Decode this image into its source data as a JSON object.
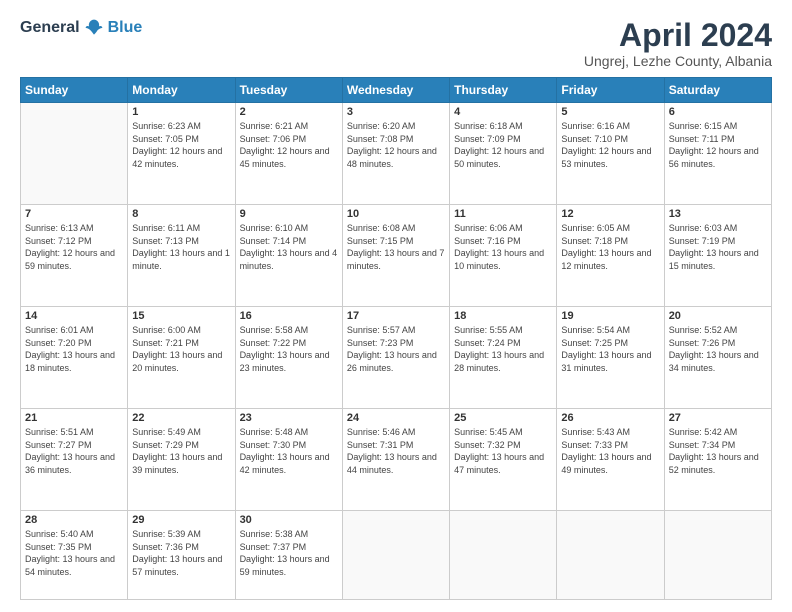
{
  "header": {
    "logo_general": "General",
    "logo_blue": "Blue",
    "month": "April 2024",
    "location": "Ungrej, Lezhe County, Albania"
  },
  "days_of_week": [
    "Sunday",
    "Monday",
    "Tuesday",
    "Wednesday",
    "Thursday",
    "Friday",
    "Saturday"
  ],
  "weeks": [
    [
      {
        "day": "",
        "sunrise": "",
        "sunset": "",
        "daylight": ""
      },
      {
        "day": "1",
        "sunrise": "Sunrise: 6:23 AM",
        "sunset": "Sunset: 7:05 PM",
        "daylight": "Daylight: 12 hours and 42 minutes."
      },
      {
        "day": "2",
        "sunrise": "Sunrise: 6:21 AM",
        "sunset": "Sunset: 7:06 PM",
        "daylight": "Daylight: 12 hours and 45 minutes."
      },
      {
        "day": "3",
        "sunrise": "Sunrise: 6:20 AM",
        "sunset": "Sunset: 7:08 PM",
        "daylight": "Daylight: 12 hours and 48 minutes."
      },
      {
        "day": "4",
        "sunrise": "Sunrise: 6:18 AM",
        "sunset": "Sunset: 7:09 PM",
        "daylight": "Daylight: 12 hours and 50 minutes."
      },
      {
        "day": "5",
        "sunrise": "Sunrise: 6:16 AM",
        "sunset": "Sunset: 7:10 PM",
        "daylight": "Daylight: 12 hours and 53 minutes."
      },
      {
        "day": "6",
        "sunrise": "Sunrise: 6:15 AM",
        "sunset": "Sunset: 7:11 PM",
        "daylight": "Daylight: 12 hours and 56 minutes."
      }
    ],
    [
      {
        "day": "7",
        "sunrise": "Sunrise: 6:13 AM",
        "sunset": "Sunset: 7:12 PM",
        "daylight": "Daylight: 12 hours and 59 minutes."
      },
      {
        "day": "8",
        "sunrise": "Sunrise: 6:11 AM",
        "sunset": "Sunset: 7:13 PM",
        "daylight": "Daylight: 13 hours and 1 minute."
      },
      {
        "day": "9",
        "sunrise": "Sunrise: 6:10 AM",
        "sunset": "Sunset: 7:14 PM",
        "daylight": "Daylight: 13 hours and 4 minutes."
      },
      {
        "day": "10",
        "sunrise": "Sunrise: 6:08 AM",
        "sunset": "Sunset: 7:15 PM",
        "daylight": "Daylight: 13 hours and 7 minutes."
      },
      {
        "day": "11",
        "sunrise": "Sunrise: 6:06 AM",
        "sunset": "Sunset: 7:16 PM",
        "daylight": "Daylight: 13 hours and 10 minutes."
      },
      {
        "day": "12",
        "sunrise": "Sunrise: 6:05 AM",
        "sunset": "Sunset: 7:18 PM",
        "daylight": "Daylight: 13 hours and 12 minutes."
      },
      {
        "day": "13",
        "sunrise": "Sunrise: 6:03 AM",
        "sunset": "Sunset: 7:19 PM",
        "daylight": "Daylight: 13 hours and 15 minutes."
      }
    ],
    [
      {
        "day": "14",
        "sunrise": "Sunrise: 6:01 AM",
        "sunset": "Sunset: 7:20 PM",
        "daylight": "Daylight: 13 hours and 18 minutes."
      },
      {
        "day": "15",
        "sunrise": "Sunrise: 6:00 AM",
        "sunset": "Sunset: 7:21 PM",
        "daylight": "Daylight: 13 hours and 20 minutes."
      },
      {
        "day": "16",
        "sunrise": "Sunrise: 5:58 AM",
        "sunset": "Sunset: 7:22 PM",
        "daylight": "Daylight: 13 hours and 23 minutes."
      },
      {
        "day": "17",
        "sunrise": "Sunrise: 5:57 AM",
        "sunset": "Sunset: 7:23 PM",
        "daylight": "Daylight: 13 hours and 26 minutes."
      },
      {
        "day": "18",
        "sunrise": "Sunrise: 5:55 AM",
        "sunset": "Sunset: 7:24 PM",
        "daylight": "Daylight: 13 hours and 28 minutes."
      },
      {
        "day": "19",
        "sunrise": "Sunrise: 5:54 AM",
        "sunset": "Sunset: 7:25 PM",
        "daylight": "Daylight: 13 hours and 31 minutes."
      },
      {
        "day": "20",
        "sunrise": "Sunrise: 5:52 AM",
        "sunset": "Sunset: 7:26 PM",
        "daylight": "Daylight: 13 hours and 34 minutes."
      }
    ],
    [
      {
        "day": "21",
        "sunrise": "Sunrise: 5:51 AM",
        "sunset": "Sunset: 7:27 PM",
        "daylight": "Daylight: 13 hours and 36 minutes."
      },
      {
        "day": "22",
        "sunrise": "Sunrise: 5:49 AM",
        "sunset": "Sunset: 7:29 PM",
        "daylight": "Daylight: 13 hours and 39 minutes."
      },
      {
        "day": "23",
        "sunrise": "Sunrise: 5:48 AM",
        "sunset": "Sunset: 7:30 PM",
        "daylight": "Daylight: 13 hours and 42 minutes."
      },
      {
        "day": "24",
        "sunrise": "Sunrise: 5:46 AM",
        "sunset": "Sunset: 7:31 PM",
        "daylight": "Daylight: 13 hours and 44 minutes."
      },
      {
        "day": "25",
        "sunrise": "Sunrise: 5:45 AM",
        "sunset": "Sunset: 7:32 PM",
        "daylight": "Daylight: 13 hours and 47 minutes."
      },
      {
        "day": "26",
        "sunrise": "Sunrise: 5:43 AM",
        "sunset": "Sunset: 7:33 PM",
        "daylight": "Daylight: 13 hours and 49 minutes."
      },
      {
        "day": "27",
        "sunrise": "Sunrise: 5:42 AM",
        "sunset": "Sunset: 7:34 PM",
        "daylight": "Daylight: 13 hours and 52 minutes."
      }
    ],
    [
      {
        "day": "28",
        "sunrise": "Sunrise: 5:40 AM",
        "sunset": "Sunset: 7:35 PM",
        "daylight": "Daylight: 13 hours and 54 minutes."
      },
      {
        "day": "29",
        "sunrise": "Sunrise: 5:39 AM",
        "sunset": "Sunset: 7:36 PM",
        "daylight": "Daylight: 13 hours and 57 minutes."
      },
      {
        "day": "30",
        "sunrise": "Sunrise: 5:38 AM",
        "sunset": "Sunset: 7:37 PM",
        "daylight": "Daylight: 13 hours and 59 minutes."
      },
      {
        "day": "",
        "sunrise": "",
        "sunset": "",
        "daylight": ""
      },
      {
        "day": "",
        "sunrise": "",
        "sunset": "",
        "daylight": ""
      },
      {
        "day": "",
        "sunrise": "",
        "sunset": "",
        "daylight": ""
      },
      {
        "day": "",
        "sunrise": "",
        "sunset": "",
        "daylight": ""
      }
    ]
  ]
}
